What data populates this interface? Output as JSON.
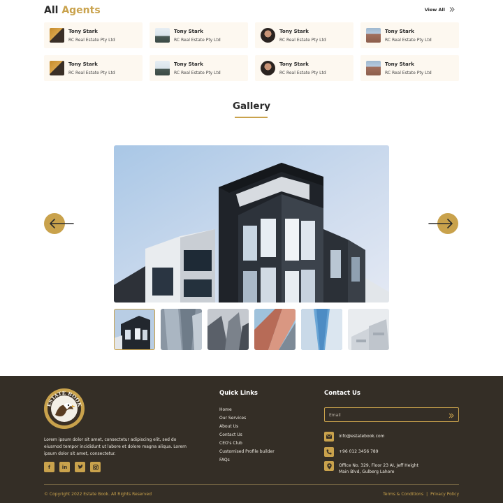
{
  "agents_section": {
    "title_main": "All",
    "title_accent": "Agents",
    "view_all_label": "View All",
    "view_all_icon": "double-chevron-right-icon",
    "agents": [
      {
        "name": "Tony Stark",
        "company": "RC Real Estate Pty Ltd"
      },
      {
        "name": "Tony Stark",
        "company": "RC Real Estate Pty Ltd"
      },
      {
        "name": "Tony Stark",
        "company": "RC Real Estate Pty Ltd"
      },
      {
        "name": "Tony Stark",
        "company": "RC Real Estate Pty Ltd"
      },
      {
        "name": "Tony Stark",
        "company": "RC Real Estate Pty Ltd"
      },
      {
        "name": "Tony Stark",
        "company": "RC Real Estate Pty Ltd"
      },
      {
        "name": "Tony Stark",
        "company": "RC Real Estate Pty Ltd"
      },
      {
        "name": "Tony Stark",
        "company": "RC Real Estate Pty Ltd"
      }
    ]
  },
  "gallery": {
    "title": "Gallery",
    "prev_icon": "arrow-left-icon",
    "next_icon": "arrow-right-icon",
    "thumbnail_count": 6,
    "active_thumbnail": 1
  },
  "footer": {
    "logo_text": "ESTATE BOOK",
    "description": "Lorem ipsum dolor sit amet, consectetur adipiscing elit, sed do eiusmod tempor incididunt ut labore et dolore magna aliqua. Lorem ipsum dolor sit amet, consectetur.",
    "social": [
      "facebook-icon",
      "linkedin-icon",
      "twitter-icon",
      "instagram-icon"
    ],
    "quick_links_title": "Quick Links",
    "quick_links": [
      "Home",
      "Our Services",
      "About Us",
      "Contact Us",
      "CEO's Club",
      "Customised Profile builder",
      "FAQs"
    ],
    "contact_title": "Contact Us",
    "email_placeholder": "Email",
    "email": "info@estatebook.com",
    "phone": "+96 012 3456 789",
    "address_line1": "Office No. 329, Floor 23 AI, Jeff Height",
    "address_line2": "Main Blvd, Gulberg Lahore",
    "copyright": "© Copyright 2022 Estate Book. All Rights Reserved",
    "terms": "Terms & Conditions",
    "privacy": "Privacy Policy",
    "legal_separator": "|"
  },
  "colors": {
    "accent": "#c9a24c",
    "footer_bg": "#342e26",
    "card_bg": "#fdf8f0",
    "heading": "#2b2b2b"
  }
}
